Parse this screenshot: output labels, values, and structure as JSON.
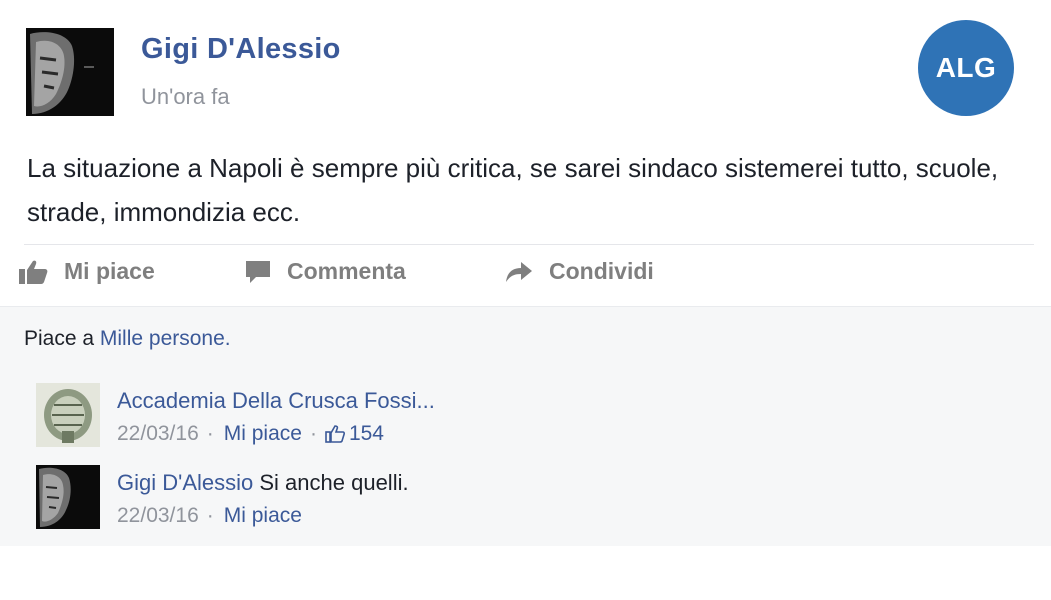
{
  "post": {
    "author": "Gigi D'Alessio",
    "time": "Un'ora fa",
    "badge": "ALG",
    "text": "La situazione a Napoli è sempre più critica, se sarei sindaco sistemerei tutto, scuole, strade, immondizia ecc."
  },
  "actions": {
    "like": "Mi piace",
    "comment": "Commenta",
    "share": "Condividi"
  },
  "likes_summary": {
    "prefix": "Piace a",
    "link": "Mille persone."
  },
  "comments": [
    {
      "author": "Accademia Della Crusca Fossi...",
      "text": "",
      "date": "22/03/16",
      "like_label": "Mi piace",
      "likes": "154"
    },
    {
      "author": "Gigi D'Alessio",
      "text": "Si anche quelli.",
      "date": "22/03/16",
      "like_label": "Mi piace"
    }
  ],
  "colors": {
    "link": "#3b5998",
    "badge": "#2f73b6",
    "muted": "#90949c",
    "comments_bg": "#f6f7f8"
  },
  "icons": [
    "thumbs-up-icon",
    "comment-icon",
    "share-arrow-icon",
    "small-thumbs-up-icon"
  ]
}
